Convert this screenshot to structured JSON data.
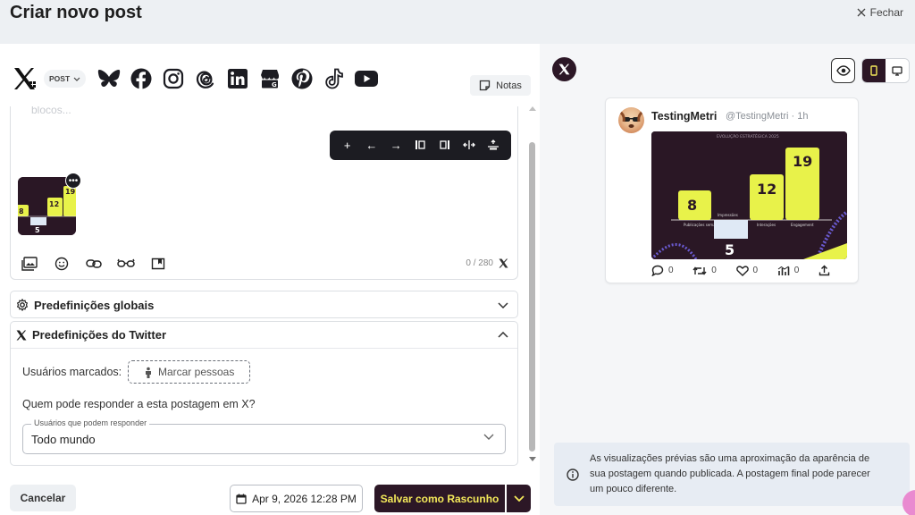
{
  "header": {
    "title": "Criar novo post",
    "close_label": "Fechar"
  },
  "networks": {
    "post_type": "POST",
    "items": [
      "x-twitter",
      "bluesky",
      "facebook",
      "instagram",
      "threads",
      "linkedin",
      "google-business",
      "pinterest",
      "tiktok",
      "youtube"
    ]
  },
  "notes_label": "Notas",
  "editor": {
    "placeholder_fragment": "blocos...",
    "char_count": "0 / 280"
  },
  "panels": {
    "global_label": "Predefinições globais",
    "twitter_label": "Predefinições do Twitter",
    "tag_label": "Usuários marcados:",
    "tag_button": "Marcar pessoas",
    "reply_question": "Quem pode responder a esta postagem em X?",
    "reply_legend": "Usuários que podem responder",
    "reply_value": "Todo mundo"
  },
  "footer": {
    "cancel_label": "Cancelar",
    "date_label": "Apr 9, 2026 12:28 PM",
    "draft_label": "Salvar como Rascunho"
  },
  "preview": {
    "name": "TestingMetri",
    "handle": "@TestingMetri · 1h",
    "replies": "0",
    "retweets": "0",
    "likes": "0",
    "views": "0",
    "image": {
      "heading": "EVOLUÇÃO ESTRATÉGICA 2025",
      "bars": [
        {
          "value": "8",
          "label": "Publicações semanais"
        },
        {
          "value": "5",
          "label": "Impressões"
        },
        {
          "value": "12",
          "label": "Interações"
        },
        {
          "value": "19",
          "label": "Engagement"
        }
      ],
      "accent": "#e8f24a",
      "background": "#2a1725"
    },
    "info_text": "As visualizações prévias são uma aproximação da aparência de sua postagem quando publicada. A postagem final pode parecer um pouco diferente."
  },
  "colors": {
    "brand_dark": "#2c1726",
    "brand_yellow": "#f4ea5a"
  }
}
